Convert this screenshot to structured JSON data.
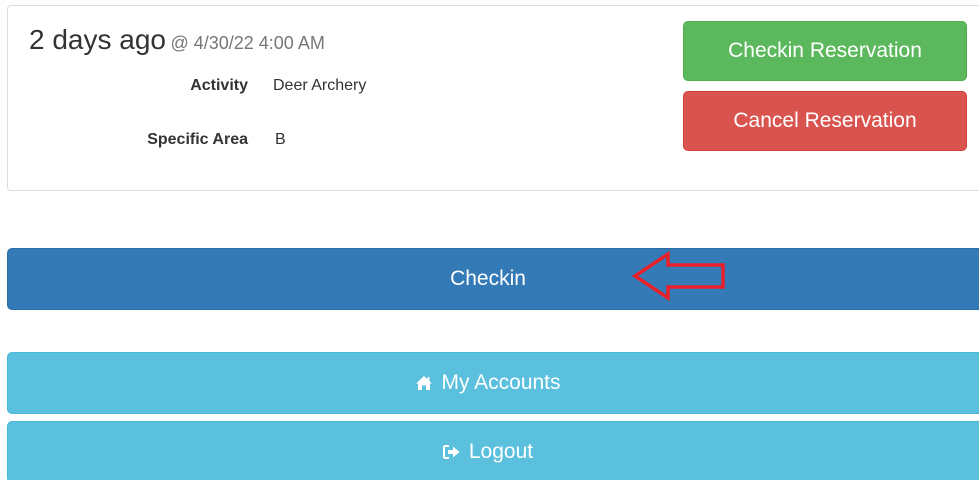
{
  "reservation": {
    "relative_time": "2 days ago",
    "datetime": "@ 4/30/22 4:00 AM",
    "fields": [
      {
        "label": "Activity",
        "value": "Deer Archery"
      },
      {
        "label": "Specific Area",
        "value": "B"
      }
    ],
    "checkin_reservation_label": "Checkin Reservation",
    "cancel_reservation_label": "Cancel Reservation"
  },
  "actions": {
    "checkin_label": "Checkin",
    "my_accounts_label": "My Accounts",
    "logout_label": "Logout"
  },
  "icons": {
    "accounts": "home-icon",
    "logout": "sign-out-icon",
    "annotation": "arrow-left-icon"
  },
  "colors": {
    "success": "#5cb85c",
    "danger": "#d9534f",
    "primary": "#337ab7",
    "info": "#5bc0de",
    "annotation": "#e8202a"
  }
}
